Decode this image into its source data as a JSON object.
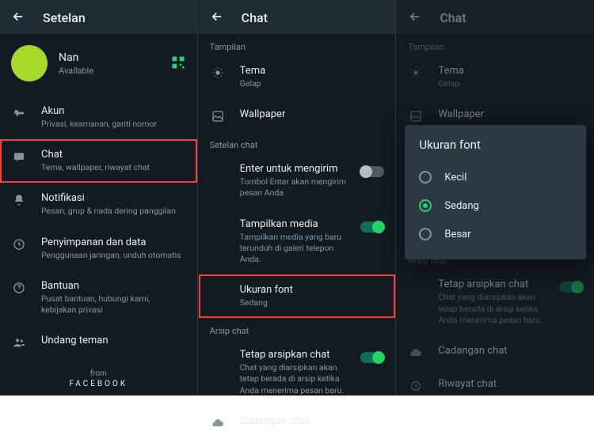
{
  "pane1": {
    "header": "Setelan",
    "profile": {
      "name": "Nan",
      "status": "Available"
    },
    "items": {
      "akun": {
        "label": "Akun",
        "desc": "Privasi, keamanan, ganti nomor"
      },
      "chat": {
        "label": "Chat",
        "desc": "Tema, wallpaper, riwayat chat"
      },
      "notif": {
        "label": "Notifikasi",
        "desc": "Pesan, grup & nada dering panggilan"
      },
      "data": {
        "label": "Penyimpanan dan data",
        "desc": "Penggunaan jaringan, unduh otomatis"
      },
      "help": {
        "label": "Bantuan",
        "desc": "Pusat bantuan, hubungi kami, kebijakan privasi"
      },
      "invite": {
        "label": "Undang teman"
      }
    },
    "footer": {
      "from": "from",
      "company": "FACEBOOK"
    }
  },
  "pane2": {
    "header": "Chat",
    "sectionDisplay": "Tampilan",
    "theme": {
      "label": "Tema",
      "value": "Gelap"
    },
    "wallpaper": {
      "label": "Wallpaper"
    },
    "sectionChat": "Setelan chat",
    "enter": {
      "label": "Enter untuk mengirim",
      "desc": "Tombol Enter akan mengirim pesan Anda"
    },
    "media": {
      "label": "Tampilkan media",
      "desc": "Tampilkan media yang baru terunduh di galeri telepon Anda."
    },
    "font": {
      "label": "Ukuran font",
      "value": "Sedang"
    },
    "sectionArchive": "Arsip chat",
    "archive": {
      "label": "Tetap arsipkan chat",
      "desc": "Chat yang diarsipkan akan tetap berada di arsip ketika Anda menerima pesan baru."
    },
    "backup": {
      "label": "Cadangan chat"
    },
    "history": {
      "label": "Riwayat chat"
    }
  },
  "dialog": {
    "title": "Ukuran font",
    "options": {
      "0": "Kecil",
      "1": "Sedang",
      "2": "Besar"
    }
  }
}
